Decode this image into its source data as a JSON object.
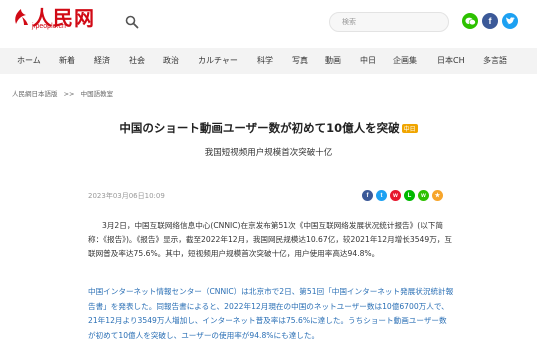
{
  "header": {
    "logo_text": "人民网",
    "logo_url_text": "j.people.cn",
    "search_placeholder": "検索",
    "colors": {
      "brand_red": "#d10a15",
      "wechat_green": "#2dc100",
      "facebook_blue": "#3b5998",
      "twitter_blue": "#1da1f2"
    }
  },
  "nav": {
    "items": [
      "ホーム",
      "新着",
      "経済",
      "社会",
      "政治",
      "カルチャー",
      "科学",
      "写真",
      "動画",
      "中日",
      "企画集",
      "日本CH",
      "多言語"
    ]
  },
  "breadcrumb": {
    "home": "人民網日本語版",
    "separator": ">>",
    "section": "中国語教室"
  },
  "article": {
    "title": "中国のショート動画ユーザー数が初めて10億人を突破",
    "title_badge": "中日",
    "subtitle": "我国短视频用户规模首次突破十亿",
    "date": "2023年03月06日10:09",
    "share_icons": [
      "facebook-icon",
      "twitter-icon",
      "weibo-icon",
      "line-icon",
      "wechat-icon",
      "qzone-icon"
    ],
    "paragraph_cn": "3月2日，中国互联网络信息中心(CNNIC)在京发布第51次《中国互联网络发展状况统计报告》(以下简称：《报告》)。《报告》显示，截至2022年12月，我国网民规模达10.67亿，较2021年12月增长3549万，互联网普及率达75.6%。其中，短视频用户规模首次突破十亿，用户使用率高达94.8%。",
    "paragraph_jp": "中国インターネット情報センター（CNNIC）は北京市で2日、第51回「中国インターネット発展状況統計報告書」を発表した。同報告書によると、2022年12月現在の中国のネットユーザー数は10億6700万人で、21年12月より3549万人増加し、インターネット普及率は75.6%に達した。うちショート動画ユーザー数が初めて10億人を突破し、ユーザーの使用率が94.8%にも達した。"
  }
}
